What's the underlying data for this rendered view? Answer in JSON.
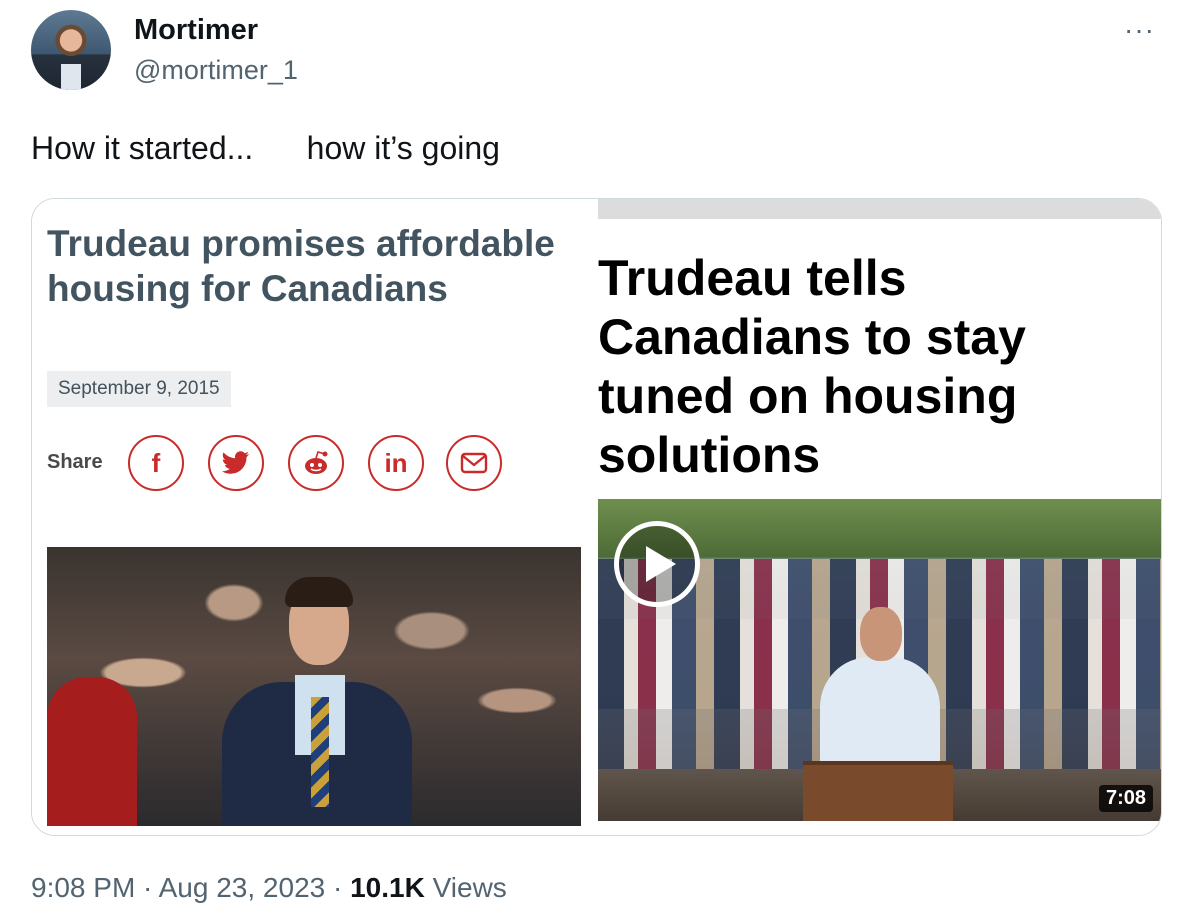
{
  "author": {
    "display_name": "Mortimer",
    "handle": "@mortimer_1",
    "avatar_icon": "profile-avatar"
  },
  "more_icon": "more-horizontal-icon",
  "tweet": {
    "text": "How it started...      how it’s going"
  },
  "left_image": {
    "headline": "Trudeau promises affordable housing for Canadians",
    "date": "September 9, 2015",
    "share_label": "Share",
    "share_icons": [
      "facebook-icon",
      "twitter-icon",
      "reddit-icon",
      "linkedin-icon",
      "email-icon"
    ],
    "share_glyphs": [
      "f",
      "t",
      "r",
      "in",
      "✉"
    ],
    "accent_color": "#c92a2a"
  },
  "right_image": {
    "headline": "Trudeau tells Canadians to stay tuned on housing solutions",
    "duration": "7:08"
  },
  "footer": {
    "time": "9:08 PM",
    "date": "Aug 23, 2023",
    "separator": " · ",
    "views_count": "10.1K",
    "views_label": " Views"
  }
}
